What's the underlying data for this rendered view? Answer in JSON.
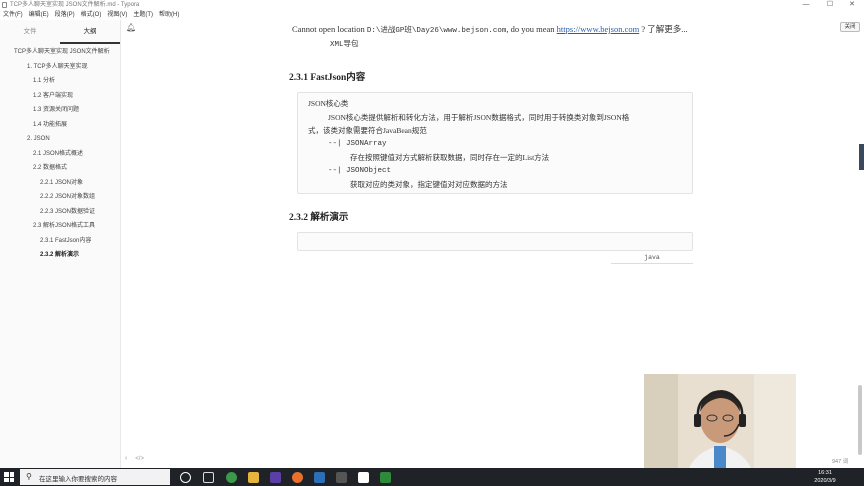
{
  "window": {
    "title": "TCP多人聊天室实现 JSON文件解析.md - Typora",
    "controls": {
      "minimize": "—",
      "maximize": "☐",
      "close": "✕"
    }
  },
  "menu": [
    "文件(F)",
    "编辑(E)",
    "段落(P)",
    "格式(O)",
    "视图(V)",
    "主题(T)",
    "帮助(H)"
  ],
  "sidebar": {
    "tabs": {
      "files": "文件",
      "outline": "大纲"
    },
    "outline": [
      {
        "label": "TCP多人聊天室实现 JSON文件解析",
        "level": 0
      },
      {
        "label": "1. TCP多人聊天室实现",
        "level": 1
      },
      {
        "label": "1.1 分析",
        "level": 2
      },
      {
        "label": "1.2 客户端实现",
        "level": 2
      },
      {
        "label": "1.3 资源关闭问题",
        "level": 2
      },
      {
        "label": "1.4 功能拓展",
        "level": 2
      },
      {
        "label": "2. JSON",
        "level": 1
      },
      {
        "label": "2.1 JSON格式概述",
        "level": 2
      },
      {
        "label": "2.2 数据格式",
        "level": 2
      },
      {
        "label": "2.2.1 JSON对象",
        "level": 3
      },
      {
        "label": "2.2.2 JSON对象数组",
        "level": 3
      },
      {
        "label": "2.2.3 JSON数据验证",
        "level": 3
      },
      {
        "label": "2.3 解析JSON格式工具",
        "level": 2
      },
      {
        "label": "2.3.1 FastJson内容",
        "level": 3
      },
      {
        "label": "2.3.2 解析演示",
        "level": 3,
        "active": true
      }
    ],
    "footer_left": "‹",
    "footer_code": "</>"
  },
  "notification": {
    "prefix": "Cannot open location ",
    "path": "D:\\进战GP班\\Day26\\www.bejson.com",
    "middle": ", do you mean ",
    "link": "https://www.bejson.com",
    "suffix": " ? 了解更多...",
    "close_label": "关闭"
  },
  "editor": {
    "xml_line": "XML导包",
    "heading_1": "2.3.1 FastJson内容",
    "code_block_1": [
      "JSON核心类",
      "    JSON核心类提供解析和转化方法，用于解析JSON数据格式，同时用于转换类对象到JSON格",
      "式，该类对象需要符合JavaBean规范",
      "    --| JSONArray",
      "        存在按照键值对方式解析获取数据，同时存在一定的List方法",
      "    --| JSONObject",
      "        获取对应的类对象，指定键值对对应数据的方法"
    ],
    "heading_2": "2.3.2 解析演示",
    "code_lang": "java"
  },
  "status": {
    "word_count": "947 词"
  },
  "taskbar": {
    "search_placeholder": "在这里输入你要搜索的内容",
    "time": "16:31",
    "date": "2020/3/9"
  }
}
